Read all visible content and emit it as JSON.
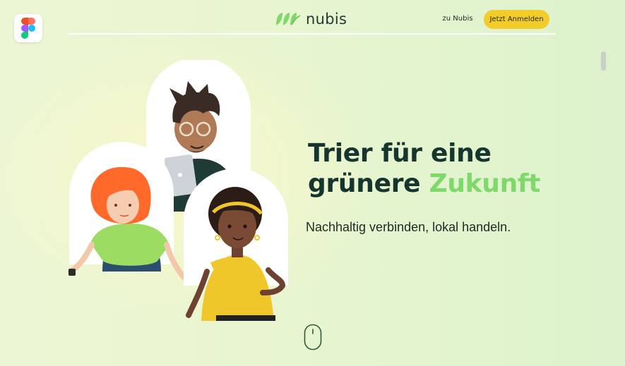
{
  "header": {
    "logo_text": "nubis",
    "nav_link": "zu Nubis",
    "cta_label": "Jetzt Anmelden"
  },
  "hero": {
    "headline_line1": "Trier für eine",
    "headline_line2_start": "grünere ",
    "headline_line2_accent": "Zukunft",
    "subline": "Nachhaltig verbinden, lokal handeln."
  },
  "icons": {
    "badge": "figma-icon",
    "scroll_hint": "mouse-scroll-icon"
  },
  "colors": {
    "accent_green": "#7ed96a",
    "cta_yellow": "#f2cc2b",
    "headline_dark": "#16352f"
  }
}
